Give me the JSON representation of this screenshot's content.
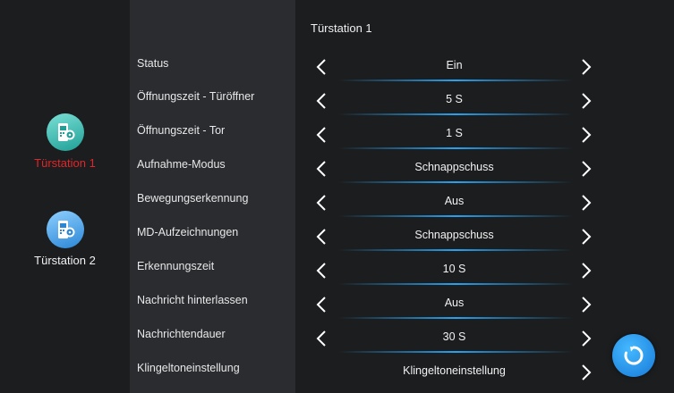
{
  "sidebar": {
    "stations": [
      {
        "label": "Türstation 1",
        "icon": "door-station-camera-icon",
        "active": true,
        "color": "#e0262a"
      },
      {
        "label": "Türstation 2",
        "icon": "door-station-camera-icon",
        "active": false
      }
    ]
  },
  "page_title": "Türstation 1",
  "settings": [
    {
      "label": "Status",
      "value": "Ein"
    },
    {
      "label": "Öffnungszeit - Türöffner",
      "value": "5 S"
    },
    {
      "label": "Öffnungszeit - Tor",
      "value": "1 S"
    },
    {
      "label": "Aufnahme-Modus",
      "value": "Schnappschuss"
    },
    {
      "label": "Bewegungserkennung",
      "value": "Aus"
    },
    {
      "label": "MD-Aufzeichnungen",
      "value": "Schnappschuss"
    },
    {
      "label": "Erkennungszeit",
      "value": "10 S"
    },
    {
      "label": "Nachricht hinterlassen",
      "value": "Aus"
    },
    {
      "label": "Nachrichtendauer",
      "value": "30 S"
    },
    {
      "label": "Klingeltoneinstellung",
      "value": "Klingeltoneinstellung"
    }
  ],
  "icons": {
    "prev": "chevron-left-icon",
    "next": "chevron-right-icon",
    "refresh": "refresh-icon"
  },
  "colors": {
    "accent": "#2aa0f0",
    "active_station": "#e0262a"
  }
}
